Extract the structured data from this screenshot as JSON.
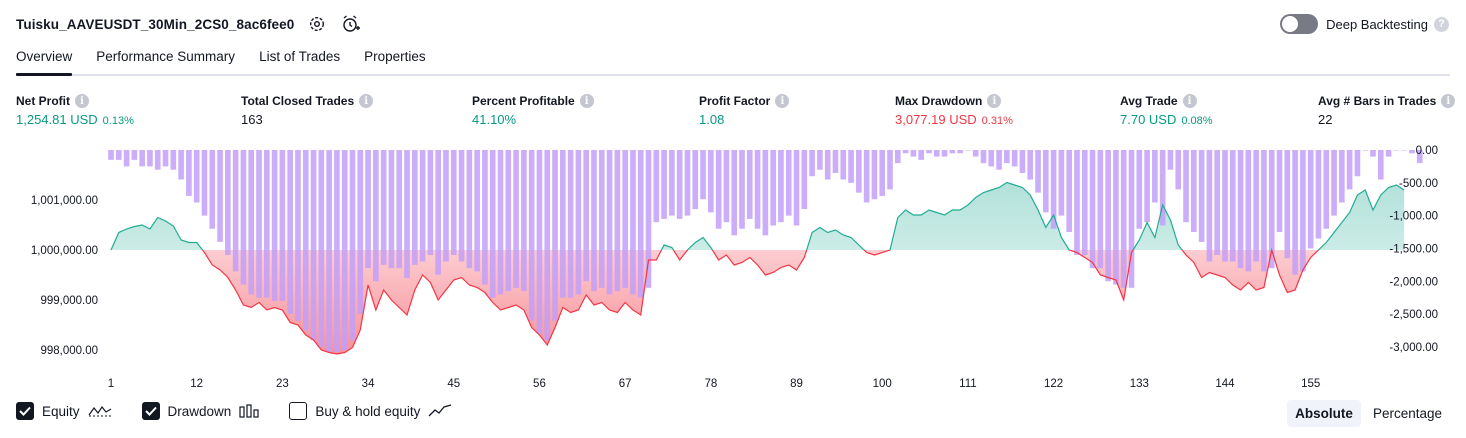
{
  "header": {
    "strategy_title": "Tuisku_AAVEUSDT_30Min_2CS0_8ac6fee0",
    "settings_icon": "gear-icon",
    "alert_icon": "alarm-clock-plus-icon"
  },
  "deep_backtesting": {
    "label": "Deep Backtesting",
    "enabled": false,
    "help": "?"
  },
  "tabs": [
    {
      "label": "Overview",
      "active": true
    },
    {
      "label": "Performance Summary",
      "active": false
    },
    {
      "label": "List of Trades",
      "active": false
    },
    {
      "label": "Properties",
      "active": false
    }
  ],
  "stats": {
    "net_profit": {
      "label": "Net Profit",
      "value": "1,254.81 USD",
      "pct": "0.13%"
    },
    "total_closed_trades": {
      "label": "Total Closed Trades",
      "value": "163"
    },
    "percent_profitable": {
      "label": "Percent Profitable",
      "value": "41.10%"
    },
    "profit_factor": {
      "label": "Profit Factor",
      "value": "1.08"
    },
    "max_drawdown": {
      "label": "Max Drawdown",
      "value": "3,077.19 USD",
      "pct": "0.31%"
    },
    "avg_trade": {
      "label": "Avg Trade",
      "value": "7.70 USD",
      "pct": "0.08%"
    },
    "avg_bars": {
      "label": "Avg # Bars in Trades",
      "value": "22"
    },
    "info_glyph": "i"
  },
  "colors": {
    "equity_up": "#22ab94",
    "equity_down": "#f23645",
    "drawdown_bar": "#c29ff8",
    "positive_text": "#089981",
    "negative_text": "#f23645"
  },
  "chart_data": {
    "type": "line",
    "x_ticks": [
      "1",
      "12",
      "23",
      "34",
      "45",
      "56",
      "67",
      "78",
      "89",
      "100",
      "111",
      "122",
      "133",
      "144",
      "155"
    ],
    "x_range": [
      1,
      163
    ],
    "series": [
      {
        "name": "Equity",
        "axis": "left",
        "baseline": 1000000,
        "ylim": [
          997800,
          1002000
        ],
        "y_ticks": [
          "1,001,000.00",
          "1,000,000.00",
          "999,000.00",
          "998,000.00"
        ],
        "y_tick_values": [
          1001000,
          1000000,
          999000,
          998000
        ],
        "values": [
          1000000,
          1000350,
          1000420,
          1000470,
          1000500,
          1000420,
          1000650,
          1000580,
          1000480,
          1000200,
          1000150,
          1000150,
          999950,
          999700,
          999600,
          999450,
          999200,
          998900,
          998850,
          998950,
          998800,
          998850,
          998800,
          998550,
          998500,
          998300,
          998200,
          998000,
          997950,
          997920,
          997950,
          998050,
          998400,
          999300,
          998800,
          999200,
          999000,
          998850,
          998700,
          999200,
          999500,
          999350,
          999000,
          999200,
          999400,
          999450,
          999300,
          999250,
          999150,
          998950,
          998800,
          998850,
          998900,
          998800,
          998450,
          998300,
          998100,
          998450,
          998850,
          998750,
          998800,
          999100,
          998900,
          998950,
          998800,
          998750,
          998950,
          998800,
          998700,
          999800,
          999800,
          1000100,
          1000050,
          999800,
          1000000,
          1000150,
          1000250,
          1000050,
          999800,
          999900,
          999700,
          999750,
          999850,
          999700,
          999500,
          999550,
          999650,
          999700,
          999600,
          999850,
          1000350,
          1000450,
          1000350,
          1000400,
          1000300,
          1000250,
          1000100,
          999950,
          999900,
          999950,
          1000000,
          1000650,
          1000800,
          1000700,
          1000700,
          1000800,
          1000750,
          1000700,
          1000800,
          1000800,
          1000900,
          1001050,
          1001150,
          1001200,
          1001250,
          1001350,
          1001300,
          1001250,
          1001100,
          1000800,
          1000450,
          1000700,
          1000250,
          1000000,
          999950,
          999850,
          999750,
          999500,
          999450,
          999400,
          999000,
          999950,
          1000200,
          1000550,
          1000250,
          1000900,
          1000600,
          1000100,
          999900,
          999750,
          999450,
          999550,
          999500,
          999450,
          999300,
          999200,
          999350,
          999200,
          999250,
          1000000,
          999500,
          999150,
          999200,
          999600,
          999850,
          1000000,
          1000150,
          1000350,
          1000550,
          1000750,
          1001100,
          1001200,
          1000800,
          1001100,
          1001250,
          1001300,
          1001200
        ]
      },
      {
        "name": "Drawdown",
        "axis": "right",
        "ylim": [
          -3200,
          0
        ],
        "y_ticks": [
          "0.00",
          "-500.00",
          "-1,000.00",
          "-1,500.00",
          "-2,000.00",
          "-2,500.00",
          "-3,000.00"
        ],
        "y_tick_values": [
          0,
          -500,
          -1000,
          -1500,
          -2000,
          -2500,
          -3000
        ],
        "values": [
          -150,
          -150,
          -250,
          -150,
          -250,
          -250,
          -300,
          -250,
          -300,
          -450,
          -700,
          -800,
          -1000,
          -1200,
          -1400,
          -1600,
          -1850,
          -2050,
          -2200,
          -2250,
          -2250,
          -2300,
          -2300,
          -2500,
          -2600,
          -2750,
          -2900,
          -3000,
          -3077,
          -3077,
          -3050,
          -2900,
          -2500,
          -1800,
          -2000,
          -1750,
          -1800,
          -1800,
          -1950,
          -1750,
          -1700,
          -1600,
          -1900,
          -1700,
          -1600,
          -1700,
          -1800,
          -1850,
          -2050,
          -2250,
          -2200,
          -2150,
          -2100,
          -2150,
          -2600,
          -2800,
          -2900,
          -2600,
          -2250,
          -2250,
          -2200,
          -2000,
          -2150,
          -2100,
          -2200,
          -2150,
          -2100,
          -2200,
          -2250,
          -2100,
          -1100,
          -1050,
          -1000,
          -1050,
          -1000,
          -900,
          -750,
          -950,
          -1200,
          -1100,
          -1300,
          -1200,
          -1050,
          -1200,
          -1300,
          -1150,
          -1100,
          -1000,
          -1150,
          -900,
          -400,
          -300,
          -450,
          -350,
          -450,
          -500,
          -650,
          -800,
          -750,
          -700,
          -600,
          -200,
          -50,
          -100,
          -150,
          -50,
          -100,
          -100,
          -50,
          -50,
          0,
          -100,
          -200,
          -250,
          -300,
          -200,
          -250,
          -350,
          -450,
          -650,
          -950,
          -1200,
          -1000,
          -1250,
          -1600,
          -1600,
          -1800,
          -1800,
          -2000,
          -2050,
          -2100,
          -2100,
          -1200,
          -1100,
          -800,
          -1150,
          -300,
          -600,
          -1100,
          -1250,
          -1400,
          -1700,
          -1600,
          -1700,
          -1700,
          -1800,
          -1850,
          -1700,
          -1850,
          -1800,
          -1250,
          -1650,
          -1900,
          -1850,
          -1500,
          -1350,
          -1200,
          -1000,
          -800,
          -600,
          -400,
          0,
          -100,
          -450,
          -100,
          0,
          0,
          -50,
          -200
        ]
      }
    ],
    "legend": [
      {
        "label": "Equity",
        "checked": true,
        "icon": "equity-line-icon"
      },
      {
        "label": "Drawdown",
        "checked": true,
        "icon": "drawdown-bars-icon"
      },
      {
        "label": "Buy & hold equity",
        "checked": false,
        "icon": "buy-hold-line-icon"
      }
    ],
    "grid": false
  },
  "view_mode": {
    "options": [
      "Absolute",
      "Percentage"
    ],
    "selected": "Absolute"
  }
}
